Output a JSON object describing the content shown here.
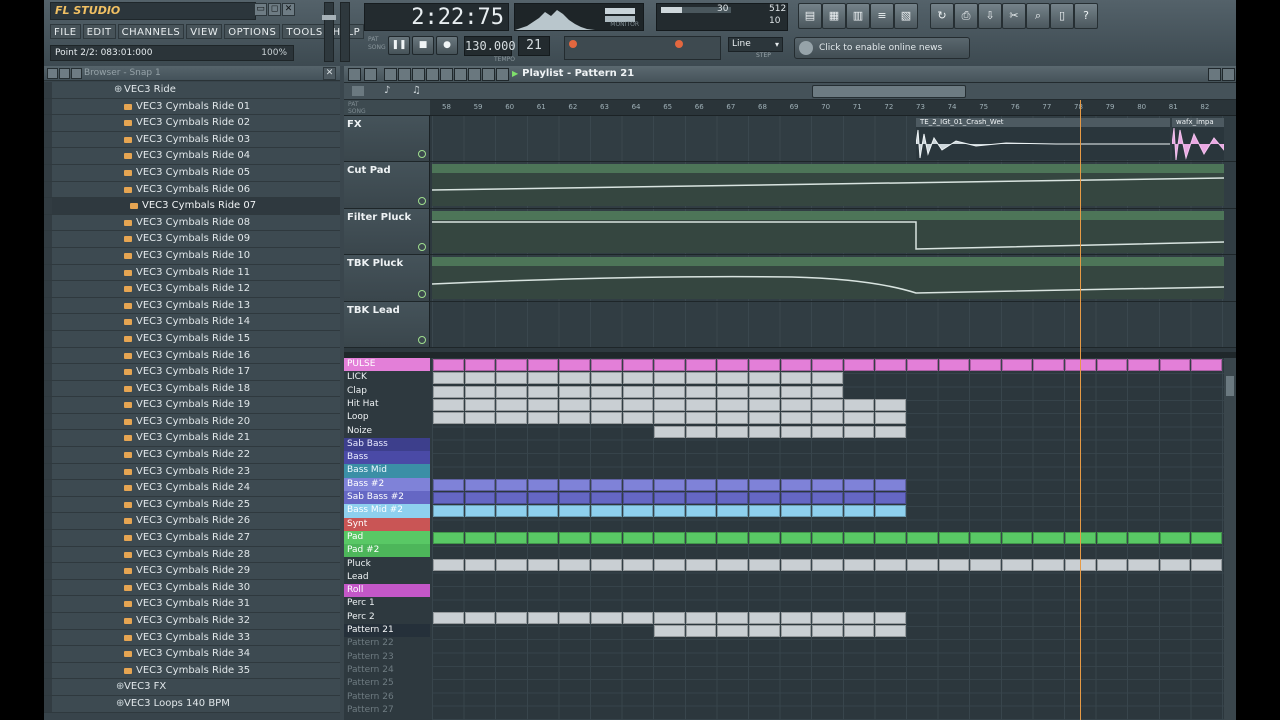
{
  "app": {
    "logo": "FL STUDIO",
    "menu": [
      "FILE",
      "EDIT",
      "CHANNELS",
      "VIEW",
      "OPTIONS",
      "TOOLS",
      "HELP"
    ],
    "hint_text": "Point 2/2: 083:01:000",
    "hint_zoom": "100%"
  },
  "transport": {
    "time": "2:22:75",
    "time_labels": [
      "PAT",
      "SONG"
    ],
    "tempo": "130.000",
    "tempo_label": "TEMPO",
    "pattern": "21",
    "cpu": "30",
    "mem": "512",
    "poly": "10",
    "monitor_label": "MONITOR",
    "snap": "Line",
    "snap_label": "STEP",
    "news": "Click to enable online news"
  },
  "browser": {
    "title": "Browser - Snap 1",
    "items": [
      {
        "label": "VEC3 Ride",
        "kind": "top"
      },
      {
        "label": "VEC3 Cymbals Ride 01"
      },
      {
        "label": "VEC3 Cymbals Ride 02"
      },
      {
        "label": "VEC3 Cymbals Ride 03"
      },
      {
        "label": "VEC3 Cymbals Ride 04"
      },
      {
        "label": "VEC3 Cymbals Ride 05"
      },
      {
        "label": "VEC3 Cymbals Ride 06"
      },
      {
        "label": "VEC3 Cymbals Ride 07",
        "kind": "hl"
      },
      {
        "label": "VEC3 Cymbals Ride 08"
      },
      {
        "label": "VEC3 Cymbals Ride 09"
      },
      {
        "label": "VEC3 Cymbals Ride 10"
      },
      {
        "label": "VEC3 Cymbals Ride 11"
      },
      {
        "label": "VEC3 Cymbals Ride 12"
      },
      {
        "label": "VEC3 Cymbals Ride 13"
      },
      {
        "label": "VEC3 Cymbals Ride 14"
      },
      {
        "label": "VEC3 Cymbals Ride 15"
      },
      {
        "label": "VEC3 Cymbals Ride 16"
      },
      {
        "label": "VEC3 Cymbals Ride 17"
      },
      {
        "label": "VEC3 Cymbals Ride 18"
      },
      {
        "label": "VEC3 Cymbals Ride 19"
      },
      {
        "label": "VEC3 Cymbals Ride 20"
      },
      {
        "label": "VEC3 Cymbals Ride 21"
      },
      {
        "label": "VEC3 Cymbals Ride 22"
      },
      {
        "label": "VEC3 Cymbals Ride 23"
      },
      {
        "label": "VEC3 Cymbals Ride 24"
      },
      {
        "label": "VEC3 Cymbals Ride 25"
      },
      {
        "label": "VEC3 Cymbals Ride 26"
      },
      {
        "label": "VEC3 Cymbals Ride 27"
      },
      {
        "label": "VEC3 Cymbals Ride 28"
      },
      {
        "label": "VEC3 Cymbals Ride 29"
      },
      {
        "label": "VEC3 Cymbals Ride 30"
      },
      {
        "label": "VEC3 Cymbals Ride 31"
      },
      {
        "label": "VEC3 Cymbals Ride 32"
      },
      {
        "label": "VEC3 Cymbals Ride 33"
      },
      {
        "label": "VEC3 Cymbals Ride 34"
      },
      {
        "label": "VEC3 Cymbals Ride 35"
      },
      {
        "label": "VEC3 FX",
        "kind": "folder"
      },
      {
        "label": "VEC3 Loops 140 BPM",
        "kind": "folder"
      }
    ]
  },
  "playlist": {
    "title": "Playlist - Pattern 21",
    "ruler_left": [
      "PAT",
      "SONG"
    ],
    "bars": [
      "58",
      "59",
      "60",
      "61",
      "62",
      "63",
      "64",
      "65",
      "66",
      "67",
      "68",
      "69",
      "70",
      "71",
      "72",
      "73",
      "74",
      "75",
      "76",
      "77",
      "78",
      "79",
      "80",
      "81",
      "82"
    ],
    "tracks": [
      {
        "name": "FX",
        "clips": [
          {
            "label": "TE_2_IGt_01_Crash_Wet"
          },
          {
            "label": "wafx_impa"
          }
        ]
      },
      {
        "name": "Cut Pad"
      },
      {
        "name": "Filter Pluck"
      },
      {
        "name": "TBK Pluck"
      },
      {
        "name": "TBK Lead"
      }
    ],
    "patterns": [
      {
        "name": "PULSE",
        "color": "#e37fd8",
        "text": "#ffffff",
        "blocks": [
          [
            0,
            25
          ]
        ]
      },
      {
        "name": "LICK",
        "color": "",
        "text": "#eef2f4",
        "blocks": [
          [
            0,
            13
          ]
        ]
      },
      {
        "name": "Clap",
        "color": "",
        "text": "#eef2f4",
        "blocks": [
          [
            0,
            13
          ]
        ]
      },
      {
        "name": "Hit Hat",
        "color": "",
        "text": "#eef2f4",
        "blocks": [
          [
            0,
            15
          ]
        ]
      },
      {
        "name": "Loop",
        "color": "",
        "text": "#eef2f4",
        "blocks": [
          [
            0,
            15
          ]
        ]
      },
      {
        "name": "Noize",
        "color": "",
        "text": "#eef2f4",
        "blocks": [
          [
            7,
            15
          ]
        ]
      },
      {
        "name": "Sab Bass",
        "color": "#3d3f8c",
        "text": "#e8eaff",
        "blocks": []
      },
      {
        "name": "Bass",
        "color": "#4a4aa6",
        "text": "#eef0ff",
        "blocks": []
      },
      {
        "name": "Bass Mid",
        "color": "#3b8fa6",
        "text": "#eefaff",
        "blocks": []
      },
      {
        "name": "Bass #2",
        "color": "#7f82d8",
        "text": "#ffffff",
        "blocks": [
          [
            0,
            15
          ]
        ]
      },
      {
        "name": "Sab Bass #2",
        "color": "#6567c4",
        "text": "#ffffff",
        "blocks": [
          [
            0,
            15
          ]
        ]
      },
      {
        "name": "Bass Mid #2",
        "color": "#8ed0ee",
        "text": "#ffffff",
        "blocks": [
          [
            0,
            15
          ]
        ]
      },
      {
        "name": "Synt",
        "color": "#c95555",
        "text": "#ffffff",
        "blocks": []
      },
      {
        "name": "Pad",
        "color": "#59c865",
        "text": "#ffffff",
        "blocks": [
          [
            0,
            25
          ]
        ]
      },
      {
        "name": "Pad #2",
        "color": "#4db65a",
        "text": "#ffffff",
        "blocks": []
      },
      {
        "name": "Pluck",
        "color": "",
        "text": "#eef2f4",
        "blocks": [
          [
            0,
            25
          ]
        ]
      },
      {
        "name": "Lead",
        "color": "",
        "text": "#eef2f4",
        "blocks": []
      },
      {
        "name": "Roll",
        "color": "#c457c8",
        "text": "#ffffff",
        "blocks": []
      },
      {
        "name": "Perc 1",
        "color": "",
        "text": "#eef2f4",
        "blocks": []
      },
      {
        "name": "Perc 2",
        "color": "",
        "text": "#eef2f4",
        "blocks": [
          [
            0,
            15
          ]
        ]
      },
      {
        "name": "Pattern 21",
        "color": "#25303a",
        "text": "#f6f8fa",
        "blocks": [
          [
            7,
            15
          ]
        ]
      },
      {
        "name": "Pattern 22",
        "color": "",
        "text": "#6e7b81",
        "blocks": []
      },
      {
        "name": "Pattern 23",
        "color": "",
        "text": "#6e7b81",
        "blocks": []
      },
      {
        "name": "Pattern 24",
        "color": "",
        "text": "#6e7b81",
        "blocks": []
      },
      {
        "name": "Pattern 25",
        "color": "",
        "text": "#6e7b81",
        "blocks": []
      },
      {
        "name": "Pattern 26",
        "color": "",
        "text": "#6e7b81",
        "blocks": []
      },
      {
        "name": "Pattern 27",
        "color": "",
        "text": "#6e7b81",
        "blocks": []
      }
    ],
    "playhead_bar": 78.2
  },
  "colors": {
    "accent": "#e69a45",
    "clip_light": "#c9cfd3",
    "auto_clip": "#4d7558"
  }
}
